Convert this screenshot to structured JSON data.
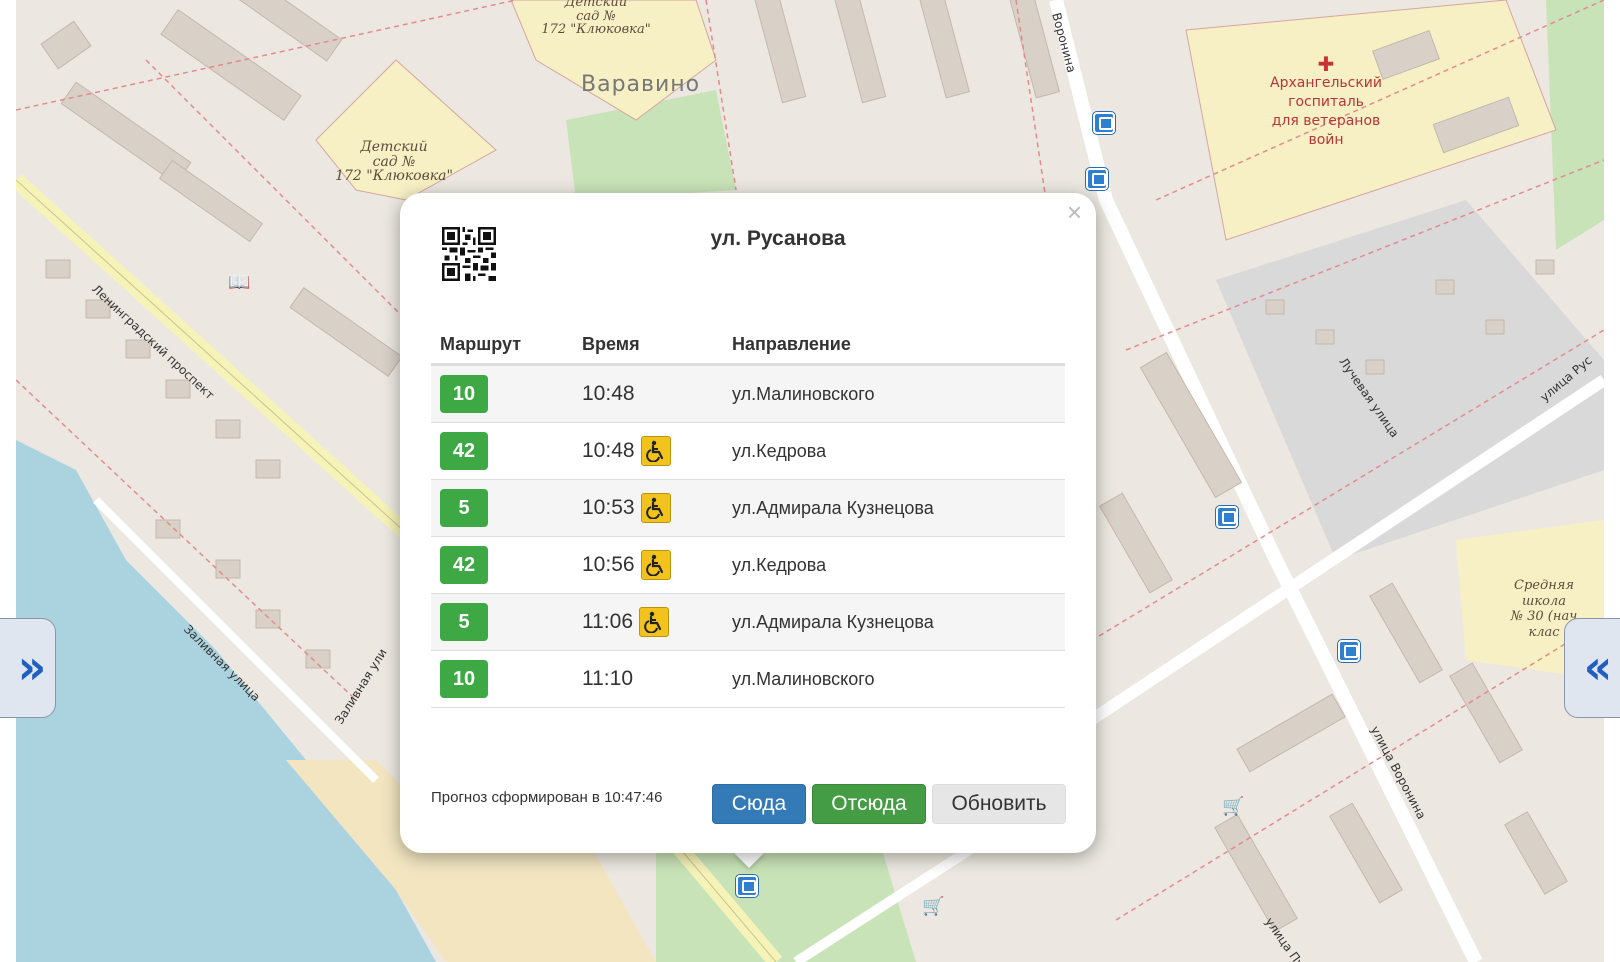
{
  "map": {
    "district_label": "Варавино",
    "kindergarten_1": [
      "Детский",
      "сад №",
      "172 \"Клюковка\""
    ],
    "kindergarten_2": [
      "Детский",
      "сад №",
      "172 \"Клюковка\""
    ],
    "hospital_label": [
      "Архангельский",
      "госпиталь",
      "для ветеранов",
      "войн"
    ],
    "school_label": [
      "Средняя",
      "школа",
      "№ 30 (нач",
      "клас"
    ],
    "streets": {
      "leningradsky": "Ленинградский проспект",
      "zalivnaya_1": "Заливная улица",
      "zalivnaya_2": "Заливная ули",
      "voronina_top": "Воронина",
      "luchevaya": "Лучевая улица",
      "voronina_bottom": "улица Воронина",
      "rus_right": "улица Рус",
      "pushk": "улица Пуш"
    }
  },
  "popup": {
    "title": "ул. Русанова",
    "close": "×",
    "headers": {
      "route": "Маршрут",
      "time": "Время",
      "direction": "Направление"
    },
    "rows": [
      {
        "route": "10",
        "time": "10:48",
        "accessible": false,
        "direction": "ул.Малиновского"
      },
      {
        "route": "42",
        "time": "10:48",
        "accessible": true,
        "direction": "ул.Кедрова"
      },
      {
        "route": "5",
        "time": "10:53",
        "accessible": true,
        "direction": "ул.Адмирала Кузнецова"
      },
      {
        "route": "42",
        "time": "10:56",
        "accessible": true,
        "direction": "ул.Кедрова"
      },
      {
        "route": "5",
        "time": "11:06",
        "accessible": true,
        "direction": "ул.Адмирала Кузнецова"
      },
      {
        "route": "10",
        "time": "11:10",
        "accessible": false,
        "direction": "ул.Малиновского"
      }
    ],
    "forecast": "Прогноз сформирован в 10:47:46",
    "buttons": {
      "here": "Сюда",
      "from": "Отсюда",
      "refresh": "Обновить"
    }
  },
  "side_tabs": {
    "left": "»",
    "right": "«"
  },
  "colors": {
    "route_badge": "#3ea845",
    "btn_here": "#337ab7",
    "btn_from": "#449d44",
    "accessible_icon": "#f2c31d"
  }
}
